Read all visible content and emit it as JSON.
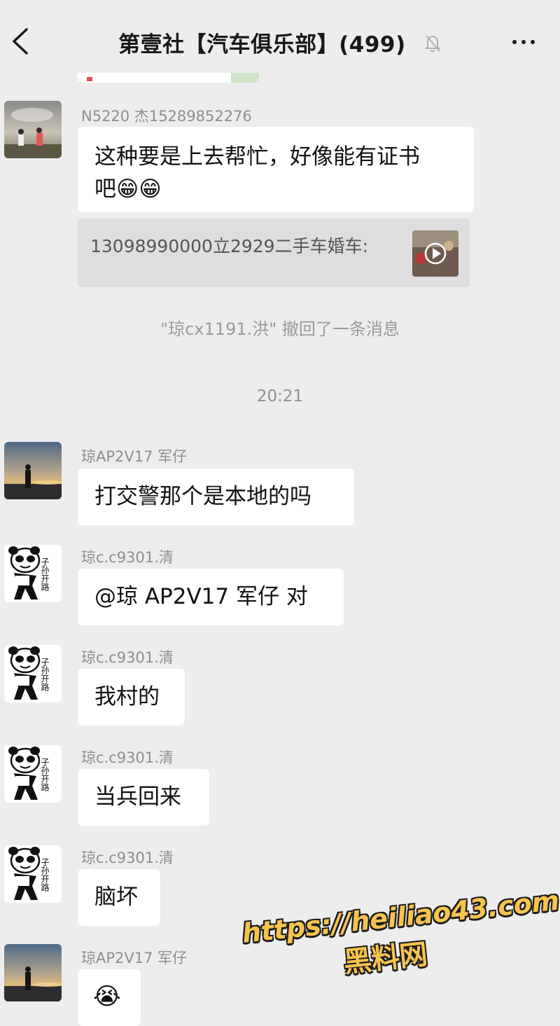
{
  "header": {
    "back_icon": "chevron-left-icon",
    "title": "第壹社【汽车俱乐部】(499)",
    "mute_icon": "bell-off-icon",
    "more_icon": "more-dots-icon"
  },
  "messages": [
    {
      "sender": "N5220  杰15289852276",
      "text_line1": "这种要是上去帮忙，好像能有证书",
      "text_line2": "吧😁😁"
    },
    {
      "sender": "琼AP2V17 军仔",
      "text": "打交警那个是本地的吗"
    },
    {
      "sender": "琼c.c9301.清",
      "text": "@琼 AP2V17 军仔  对"
    },
    {
      "sender": "琼c.c9301.清",
      "text": "我村的"
    },
    {
      "sender": "琼c.c9301.清",
      "text": "当兵回来"
    },
    {
      "sender": "琼c.c9301.清",
      "text": "脑坏"
    },
    {
      "sender": "琼AP2V17 军仔",
      "text": "😭"
    }
  ],
  "quote": {
    "text": "13098990000立2929二手车婚车:",
    "thumb_icon": "video-play-icon"
  },
  "system": {
    "recall_notice": "\"琼cx1191.洪\" 撤回了一条消息",
    "time": "20:21"
  },
  "panda_avatar_text": "子孙开路",
  "watermark": {
    "url": "https://heiliao43.com",
    "name": "黑料网"
  },
  "colors": {
    "background": "#ededed",
    "bubble": "#ffffff",
    "watermark": "#f6c34e"
  }
}
